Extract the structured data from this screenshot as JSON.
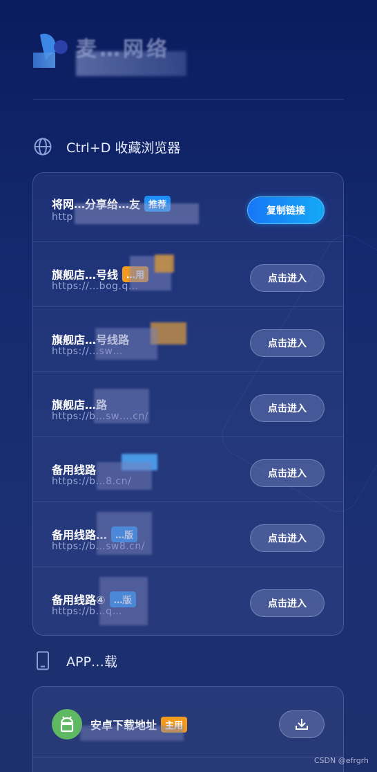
{
  "header": {
    "brand": "麦…网络"
  },
  "bookmark_section": {
    "title": "Ctrl+D 收藏浏览器"
  },
  "share_row": {
    "title": "将网…分享给…友",
    "badge": "推荐",
    "url": "http",
    "button": "复制链接"
  },
  "links": [
    {
      "title": "旗舰店…号线",
      "badge": "…用",
      "url": "https://…bog.q…",
      "button": "点击进入"
    },
    {
      "title": "旗舰店…号线路",
      "badge": "",
      "url": "https://…sw…",
      "button": "点击进入"
    },
    {
      "title": "旗舰店…路",
      "badge": "",
      "url": "https://b…sw….cn/",
      "button": "点击进入"
    },
    {
      "title": "备用线路",
      "badge": "",
      "url": "https://b…8.cn/",
      "button": "点击进入"
    },
    {
      "title": "备用线路…",
      "badge": "…版",
      "url": "https://b…sw8.cn/",
      "button": "点击进入"
    },
    {
      "title": "备用线路④",
      "badge": "…版",
      "url": "https://b…q…",
      "button": "点击进入"
    }
  ],
  "app_section": {
    "title": "APP…载"
  },
  "app_rows": [
    {
      "title": "安卓下载地址",
      "badge": "主用"
    }
  ],
  "watermark": "CSDN @efrgrh",
  "colors": {
    "primary_button": "#1776f7",
    "badge_blue": "#1f8ef5",
    "badge_orange": "#f29b1e",
    "android_green": "#5fb862"
  },
  "icons": {
    "bookmark_section": "globe-icon",
    "app_section": "phone-icon",
    "app_row": "android-icon",
    "download": "download-icon"
  }
}
